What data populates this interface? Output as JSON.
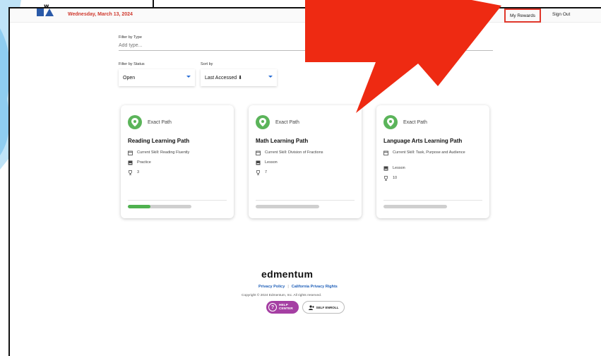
{
  "header": {
    "date": "Wednesday, March 13, 2024",
    "nav": {
      "rewards": "My Rewards",
      "signout": "Sign Out"
    }
  },
  "filters": {
    "type_label": "Filter by Type",
    "type_placeholder": "Add type...",
    "status_label": "Filter by Status",
    "status_value": "Open",
    "sort_label": "Sort by",
    "sort_value": "Last Accessed ⬇"
  },
  "cards": [
    {
      "brand": "Exact Path",
      "title": "Reading Learning Path",
      "skill": "Current Skill: Reading Fluently",
      "activity": "Practice",
      "trophies": "3",
      "progress": 0.35
    },
    {
      "brand": "Exact Path",
      "title": "Math Learning Path",
      "skill": "Current Skill: Division of Fractions",
      "activity": "Lesson",
      "trophies": "7",
      "progress": 0
    },
    {
      "brand": "Exact Path",
      "title": "Language Arts Learning Path",
      "skill": "Current Skill: Task, Purpose and Audience",
      "activity": "Lesson",
      "trophies": "10",
      "progress": 0
    }
  ],
  "footer": {
    "logo": "edmentum",
    "privacy": "Privacy Policy",
    "separator": "|",
    "ca_privacy": "California Privacy Rights",
    "copyright": "Copyright © 2024 Edmentum, Inc. All rights reserved.",
    "help_line1": "HELP",
    "help_line2": "CENTER",
    "self_enroll": "SELF ENROLL"
  },
  "colors": {
    "accent_red": "#e0372b",
    "badge_green": "#5bb45a",
    "link_blue": "#1f5fb8",
    "help_purple": "#a53fa3"
  }
}
